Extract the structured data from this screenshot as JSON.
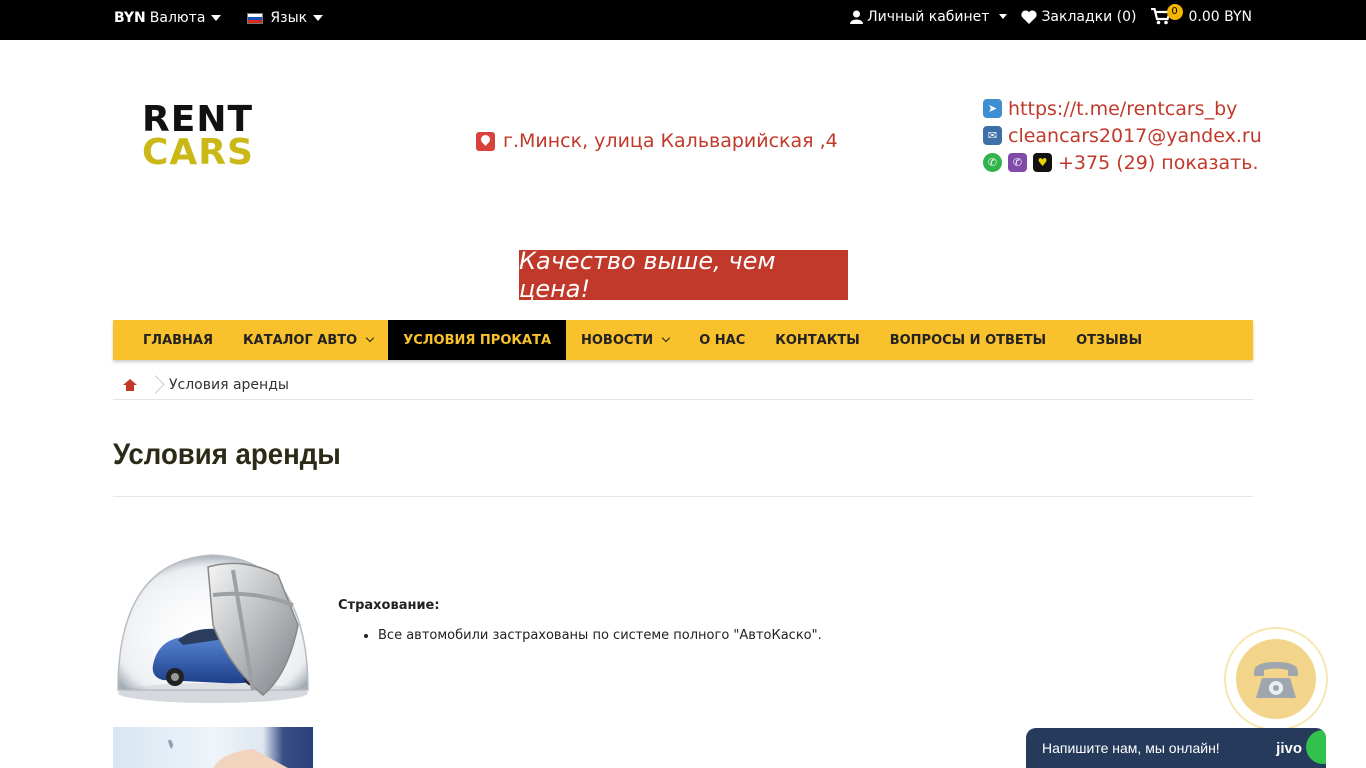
{
  "topbar": {
    "currency_code": "BYN",
    "currency_label": "Валюта",
    "language_label": "Язык",
    "account_label": "Личный кабинет",
    "wishlist_label": "Закладки (0)",
    "cart_count": "0",
    "cart_total": "0.00 BYN"
  },
  "logo": {
    "line1": "RENT",
    "line2": "CARS"
  },
  "address": "г.Минск, улица Кальварийская ,4",
  "contacts": {
    "telegram": "https://t.me/rentcars_by",
    "email": "cleancars2017@yandex.ru",
    "phone": "+375 (29) показать."
  },
  "slogan": "Качество выше, чем цена!",
  "nav": {
    "items": [
      {
        "label": "ГЛАВНАЯ"
      },
      {
        "label": "КАТАЛОГ АВТО"
      },
      {
        "label": "УСЛОВИЯ ПРОКАТА"
      },
      {
        "label": "НОВОСТИ"
      },
      {
        "label": "О НАС"
      },
      {
        "label": "КОНТАКТЫ"
      },
      {
        "label": "ВОПРОСЫ И ОТВЕТЫ"
      },
      {
        "label": "ОТЗЫВЫ"
      }
    ]
  },
  "breadcrumb": {
    "current": "Условия аренды"
  },
  "page_title": "Условия аренды",
  "insurance": {
    "label": "Страхование:",
    "items": [
      "Все автомобили застрахованы по системе полного \"АвтоКаско\"."
    ]
  },
  "chat": {
    "text": "Напишите нам, мы онлайн!",
    "brand": "jivo"
  },
  "colors": {
    "accent": "#f9c12b",
    "red": "#c0392b",
    "topbar": "#000000"
  }
}
